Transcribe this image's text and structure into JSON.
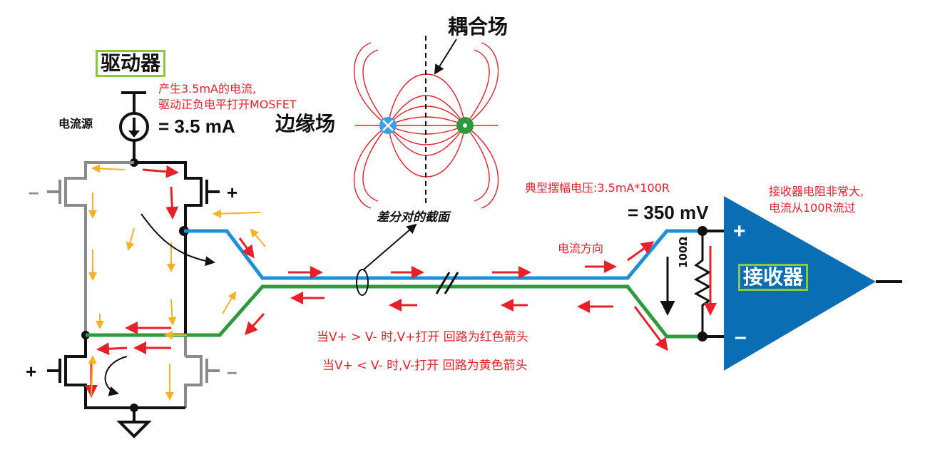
{
  "labels": {
    "driver": "驱动器",
    "driver_note_1": "产生3.5mA的电流,",
    "driver_note_2": "驱动正负电平打开MOSFET",
    "current_source": "电流源",
    "current_value": "= 3.5 mA",
    "coupling_field": "耦合场",
    "fringe_field": "边缘场",
    "cross_section": "差分对的截面",
    "typical_swing": "典型摆幅电压:3.5mA*100R",
    "swing_value": "= 350 mV",
    "receiver_note_1": "接收器电阻非常大,",
    "receiver_note_2": "电流从100R流过",
    "current_direction": "电流方向",
    "resistor": "100Ω",
    "receiver": "接收器",
    "plus": "+",
    "minus": "–",
    "rule_red": "当V+ > V- 时,V+打开 回路为红色箭头",
    "rule_yellow": "当V+ < V- 时,V-打开 回路为黄色箭头"
  },
  "colors": {
    "red": "#e8202a",
    "yellow": "#f5b324",
    "blue_line": "#1e90d8",
    "green_line": "#2e9a3e",
    "receiver_fill": "#0a6eb4",
    "box_green": "#8dc63f",
    "field_red": "#e8202a"
  }
}
